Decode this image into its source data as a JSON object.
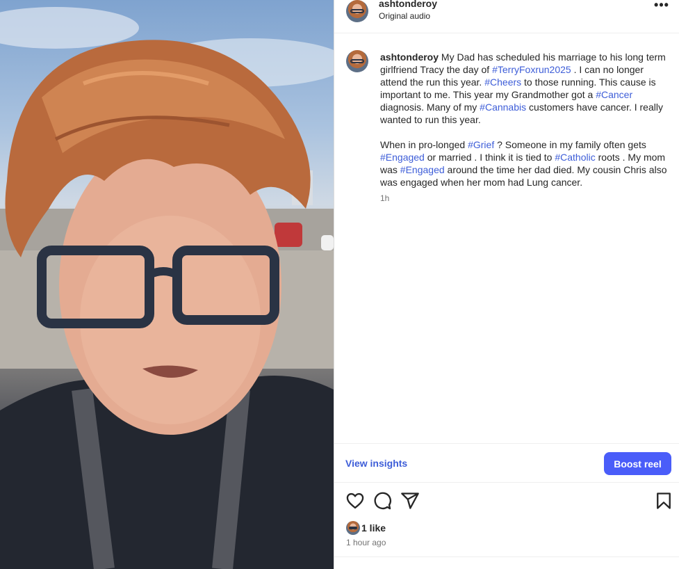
{
  "post": {
    "username": "ashtonderoy",
    "audio": "Original audio",
    "more": "•••"
  },
  "caption": {
    "username": "ashtonderoy",
    "p1": [
      " My Dad has scheduled his marriage to his long term girlfriend Tracy the day of ",
      "#TerryFoxrun2025",
      " . I can no longer attend the run this year. ",
      "#Cheers",
      " to those running. This cause is important to me. This year my Grandmother got a ",
      "#Cancer",
      " diagnosis. Many of my ",
      "#Cannabis",
      " customers have cancer. I really wanted to run this year."
    ],
    "p2": [
      "When in pro-longed ",
      "#Grief",
      " ? Someone in my family often gets ",
      "#Engaged",
      " or married . I think it is tied to ",
      "#Catholic",
      " roots . My mom was ",
      "#Engaged",
      " around the time her dad died. My cousin Chris also was engaged when her mom had Lung cancer."
    ],
    "time": "1h"
  },
  "actions": {
    "view_insights": "View insights",
    "boost": "Boost reel"
  },
  "icons": [
    "heart-icon",
    "comment-icon",
    "share-icon",
    "save-icon"
  ],
  "likes": {
    "count": "1 like",
    "time": "1 hour ago"
  },
  "colors": {
    "link": "#3d5dd8",
    "boost": "#4a5df9",
    "text": "#262626",
    "muted": "#737373"
  }
}
